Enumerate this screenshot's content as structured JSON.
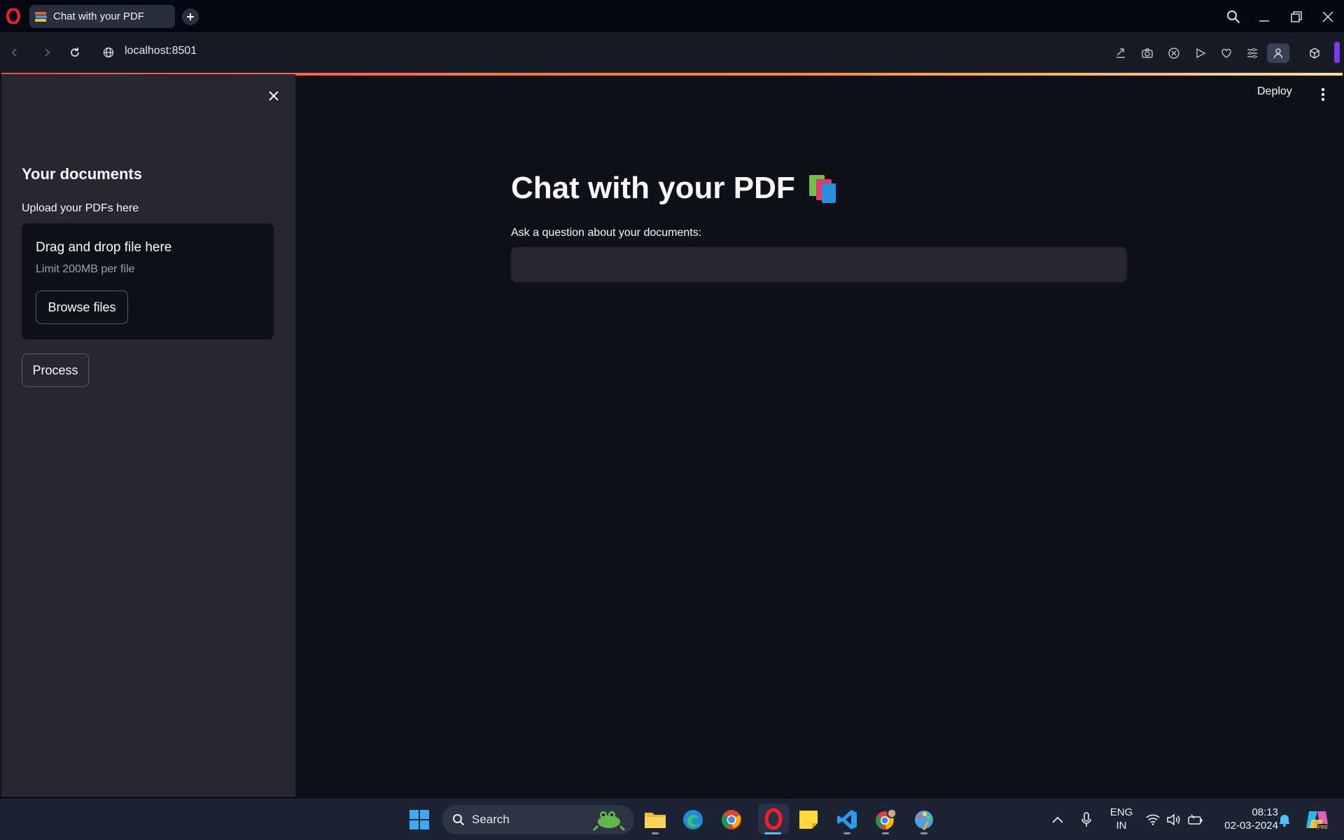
{
  "browser": {
    "tab_title": "Chat with your PDF",
    "url": "localhost:8501"
  },
  "app": {
    "deploy_label": "Deploy",
    "title": "Chat with your PDF",
    "title_emoji_icon": "books-icon",
    "question_label": "Ask a question about your documents:",
    "question_value": ""
  },
  "sidebar": {
    "heading": "Your documents",
    "upload_label": "Upload your PDFs here",
    "dropzone_title": "Drag and drop file here",
    "dropzone_limit": "Limit 200MB per file",
    "browse_label": "Browse files",
    "process_label": "Process"
  },
  "taskbar": {
    "search_placeholder": "Search",
    "language": "ENG",
    "region": "IN",
    "time": "08:13",
    "date": "02-03-2024",
    "apps": [
      "windows-start-icon",
      "file-explorer-icon",
      "edge-icon",
      "chrome-icon",
      "opera-icon",
      "sticky-notes-icon",
      "vscode-icon",
      "chrome-profile-icon",
      "paint-icon"
    ]
  },
  "colors": {
    "app_bg": "#0e1117",
    "sidebar_bg": "#262730",
    "accent_red": "#ff4b4b",
    "taskbar_bg": "#1c2433"
  }
}
